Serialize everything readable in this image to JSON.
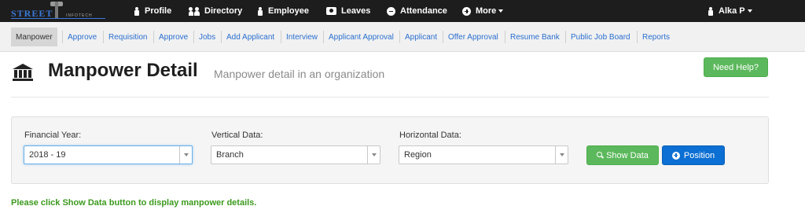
{
  "brand": {
    "logo_text": "STREET",
    "logo_subtext": "INFOTECH"
  },
  "topnav": {
    "items": [
      {
        "label": "Profile",
        "icon": "person-icon"
      },
      {
        "label": "Directory",
        "icon": "users-icon"
      },
      {
        "label": "Employee",
        "icon": "person-icon"
      },
      {
        "label": "Leaves",
        "icon": "camera-icon"
      },
      {
        "label": "Attendance",
        "icon": "minus-circle-icon"
      },
      {
        "label": "More",
        "icon": "plus-circle-icon"
      }
    ],
    "user": {
      "label": "Alka P",
      "icon": "user-icon"
    }
  },
  "subnav": {
    "items": [
      "Manpower",
      "Approve",
      "Requisition",
      "Approve",
      "Jobs",
      "Add Applicant",
      "Interview",
      "Applicant Approval",
      "Applicant",
      "Offer Approval",
      "Resume Bank",
      "Public Job Board",
      "Reports"
    ],
    "active": "Manpower"
  },
  "page": {
    "title": "Manpower Detail",
    "subtitle": "Manpower detail in an organization",
    "help_label": "Need Help?",
    "icon": "bank-icon"
  },
  "filters": {
    "financial_year": {
      "label": "Financial Year:",
      "value": "2018 - 19"
    },
    "vertical": {
      "label": "Vertical Data:",
      "value": "Branch"
    },
    "horizontal": {
      "label": "Horizontal Data:",
      "value": "Region"
    },
    "show_label": "Show Data",
    "position_label": "Position"
  },
  "message": "Please click Show Data button to display manpower details.",
  "colors": {
    "topbar": "#1d1d1d",
    "link": "#2a6fcf",
    "success": "#5cb85c",
    "primary": "#0b6fd3",
    "message": "#3c9a1e"
  }
}
